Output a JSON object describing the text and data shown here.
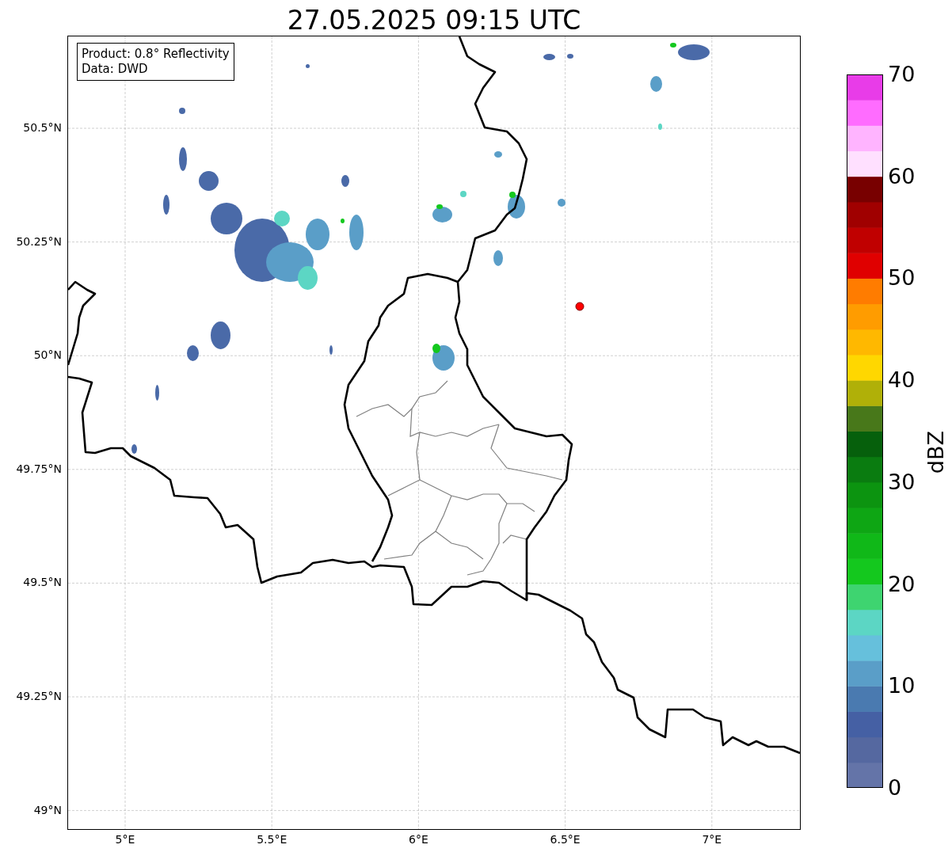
{
  "title": "27.05.2025 09:15 UTC",
  "info_box": {
    "lines": [
      "Product: 0.8° Reflectivity",
      "Data: DWD"
    ]
  },
  "map": {
    "lat_labels": [
      "50.5°N",
      "50.25°N",
      "50°N",
      "49.75°N",
      "49.5°N",
      "49.25°N",
      "49°N"
    ],
    "lon_labels": [
      "5°E",
      "5.5°E",
      "6°E",
      "6.5°E",
      "7°E"
    ]
  },
  "colorbar": {
    "label": "dBZ",
    "tick_labels": [
      "70",
      "60",
      "50",
      "40",
      "30",
      "20",
      "10",
      "0"
    ],
    "bins": [
      {
        "color": "#6474a8"
      },
      {
        "color": "#5568a0"
      },
      {
        "color": "#4560a4"
      },
      {
        "color": "#4a7ab0"
      },
      {
        "color": "#5a9ec8"
      },
      {
        "color": "#66c0dc"
      },
      {
        "color": "#5cd6c4"
      },
      {
        "color": "#3ed470"
      },
      {
        "color": "#14c81e"
      },
      {
        "color": "#10b818"
      },
      {
        "color": "#0ea614"
      },
      {
        "color": "#0c9410"
      },
      {
        "color": "#0a7c10"
      },
      {
        "color": "#06600c"
      },
      {
        "color": "#48781a"
      },
      {
        "color": "#b0b008"
      },
      {
        "color": "#ffd700"
      },
      {
        "color": "#ffb800"
      },
      {
        "color": "#ff9c00"
      },
      {
        "color": "#ff7c00"
      },
      {
        "color": "#e00000"
      },
      {
        "color": "#c00000"
      },
      {
        "color": "#a00000"
      },
      {
        "color": "#780000"
      },
      {
        "color": "#ffe0ff"
      },
      {
        "color": "#ffb4ff"
      },
      {
        "color": "#ff6cff"
      },
      {
        "color": "#e83ce8"
      }
    ]
  }
}
